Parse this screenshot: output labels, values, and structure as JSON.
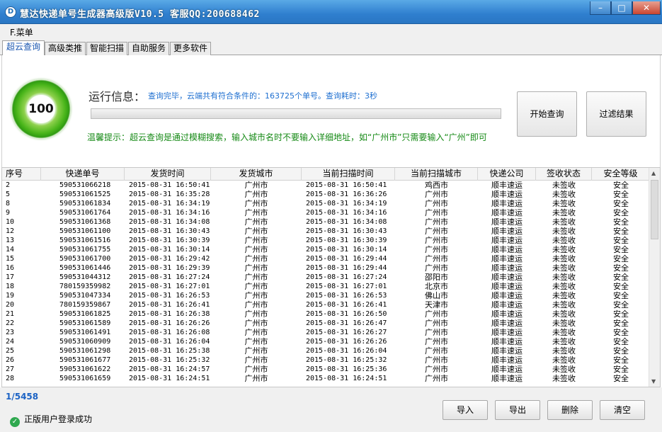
{
  "window": {
    "title": "慧达快递单号生成器高级版V10.5 客服QQ:200688462",
    "min_glyph": "–",
    "max_glyph": "□",
    "close_glyph": "✕"
  },
  "menu": {
    "label": "F.菜单"
  },
  "tabs": [
    {
      "label": "超云查询"
    },
    {
      "label": "高级类推"
    },
    {
      "label": "智能扫描"
    },
    {
      "label": "自助服务"
    },
    {
      "label": "更多软件"
    }
  ],
  "panel": {
    "score": "100",
    "run_label": "运行信息：",
    "run_status": "查询完毕，云端共有符合条件的：163725个单号。查询耗时：3秒",
    "progress": 1.0,
    "hint": "温馨提示：超云查询是通过模糊搜索，输入城市名时不要输入详细地址，如“广州市”只需要输入“广州”即可",
    "start_button": "开始查询",
    "filter_button": "过滤结果"
  },
  "table": {
    "columns": [
      "序号",
      "快递单号",
      "发货时间",
      "发货城市",
      "当前扫描时间",
      "当前扫描城市",
      "快递公司",
      "签收状态",
      "安全等级"
    ],
    "rows": [
      [
        "2",
        "590531066218",
        "2015-08-31 16:50:41",
        "广州市",
        "2015-08-31 16:50:41",
        "鸡西市",
        "顺丰速运",
        "未签收",
        "安全"
      ],
      [
        "5",
        "590531061525",
        "2015-08-31 16:35:28",
        "广州市",
        "2015-08-31 16:36:26",
        "广州市",
        "顺丰速运",
        "未签收",
        "安全"
      ],
      [
        "8",
        "590531061834",
        "2015-08-31 16:34:19",
        "广州市",
        "2015-08-31 16:34:19",
        "广州市",
        "顺丰速运",
        "未签收",
        "安全"
      ],
      [
        "9",
        "590531061764",
        "2015-08-31 16:34:16",
        "广州市",
        "2015-08-31 16:34:16",
        "广州市",
        "顺丰速运",
        "未签收",
        "安全"
      ],
      [
        "10",
        "590531061368",
        "2015-08-31 16:34:08",
        "广州市",
        "2015-08-31 16:34:08",
        "广州市",
        "顺丰速运",
        "未签收",
        "安全"
      ],
      [
        "12",
        "590531061100",
        "2015-08-31 16:30:43",
        "广州市",
        "2015-08-31 16:30:43",
        "广州市",
        "顺丰速运",
        "未签收",
        "安全"
      ],
      [
        "13",
        "590531061516",
        "2015-08-31 16:30:39",
        "广州市",
        "2015-08-31 16:30:39",
        "广州市",
        "顺丰速运",
        "未签收",
        "安全"
      ],
      [
        "14",
        "590531061755",
        "2015-08-31 16:30:14",
        "广州市",
        "2015-08-31 16:30:14",
        "广州市",
        "顺丰速运",
        "未签收",
        "安全"
      ],
      [
        "15",
        "590531061700",
        "2015-08-31 16:29:42",
        "广州市",
        "2015-08-31 16:29:44",
        "广州市",
        "顺丰速运",
        "未签收",
        "安全"
      ],
      [
        "16",
        "590531061446",
        "2015-08-31 16:29:39",
        "广州市",
        "2015-08-31 16:29:44",
        "广州市",
        "顺丰速运",
        "未签收",
        "安全"
      ],
      [
        "17",
        "590531044312",
        "2015-08-31 16:27:24",
        "广州市",
        "2015-08-31 16:27:24",
        "邵阳市",
        "顺丰速运",
        "未签收",
        "安全"
      ],
      [
        "18",
        "780159359982",
        "2015-08-31 16:27:01",
        "广州市",
        "2015-08-31 16:27:01",
        "北京市",
        "顺丰速运",
        "未签收",
        "安全"
      ],
      [
        "19",
        "590531047334",
        "2015-08-31 16:26:53",
        "广州市",
        "2015-08-31 16:26:53",
        "佛山市",
        "顺丰速运",
        "未签收",
        "安全"
      ],
      [
        "20",
        "780159359867",
        "2015-08-31 16:26:41",
        "广州市",
        "2015-08-31 16:26:41",
        "天津市",
        "顺丰速运",
        "未签收",
        "安全"
      ],
      [
        "21",
        "590531061825",
        "2015-08-31 16:26:38",
        "广州市",
        "2015-08-31 16:26:50",
        "广州市",
        "顺丰速运",
        "未签收",
        "安全"
      ],
      [
        "22",
        "590531061589",
        "2015-08-31 16:26:26",
        "广州市",
        "2015-08-31 16:26:47",
        "广州市",
        "顺丰速运",
        "未签收",
        "安全"
      ],
      [
        "23",
        "590531061491",
        "2015-08-31 16:26:08",
        "广州市",
        "2015-08-31 16:26:27",
        "广州市",
        "顺丰速运",
        "未签收",
        "安全"
      ],
      [
        "24",
        "590531060909",
        "2015-08-31 16:26:04",
        "广州市",
        "2015-08-31 16:26:26",
        "广州市",
        "顺丰速运",
        "未签收",
        "安全"
      ],
      [
        "25",
        "590531061298",
        "2015-08-31 16:25:38",
        "广州市",
        "2015-08-31 16:26:04",
        "广州市",
        "顺丰速运",
        "未签收",
        "安全"
      ],
      [
        "26",
        "590531061677",
        "2015-08-31 16:25:32",
        "广州市",
        "2015-08-31 16:25:32",
        "广州市",
        "顺丰速运",
        "未签收",
        "安全"
      ],
      [
        "27",
        "590531061622",
        "2015-08-31 16:24:57",
        "广州市",
        "2015-08-31 16:25:36",
        "广州市",
        "顺丰速运",
        "未签收",
        "安全"
      ],
      [
        "28",
        "590531061659",
        "2015-08-31 16:24:51",
        "广州市",
        "2015-08-31 16:24:51",
        "广州市",
        "顺丰速运",
        "未签收",
        "安全"
      ]
    ]
  },
  "footer": {
    "pager": "1/5458",
    "login_status": "正版用户登录成功",
    "import_button": "导入",
    "export_button": "导出",
    "delete_button": "删除",
    "clear_button": "清空"
  }
}
